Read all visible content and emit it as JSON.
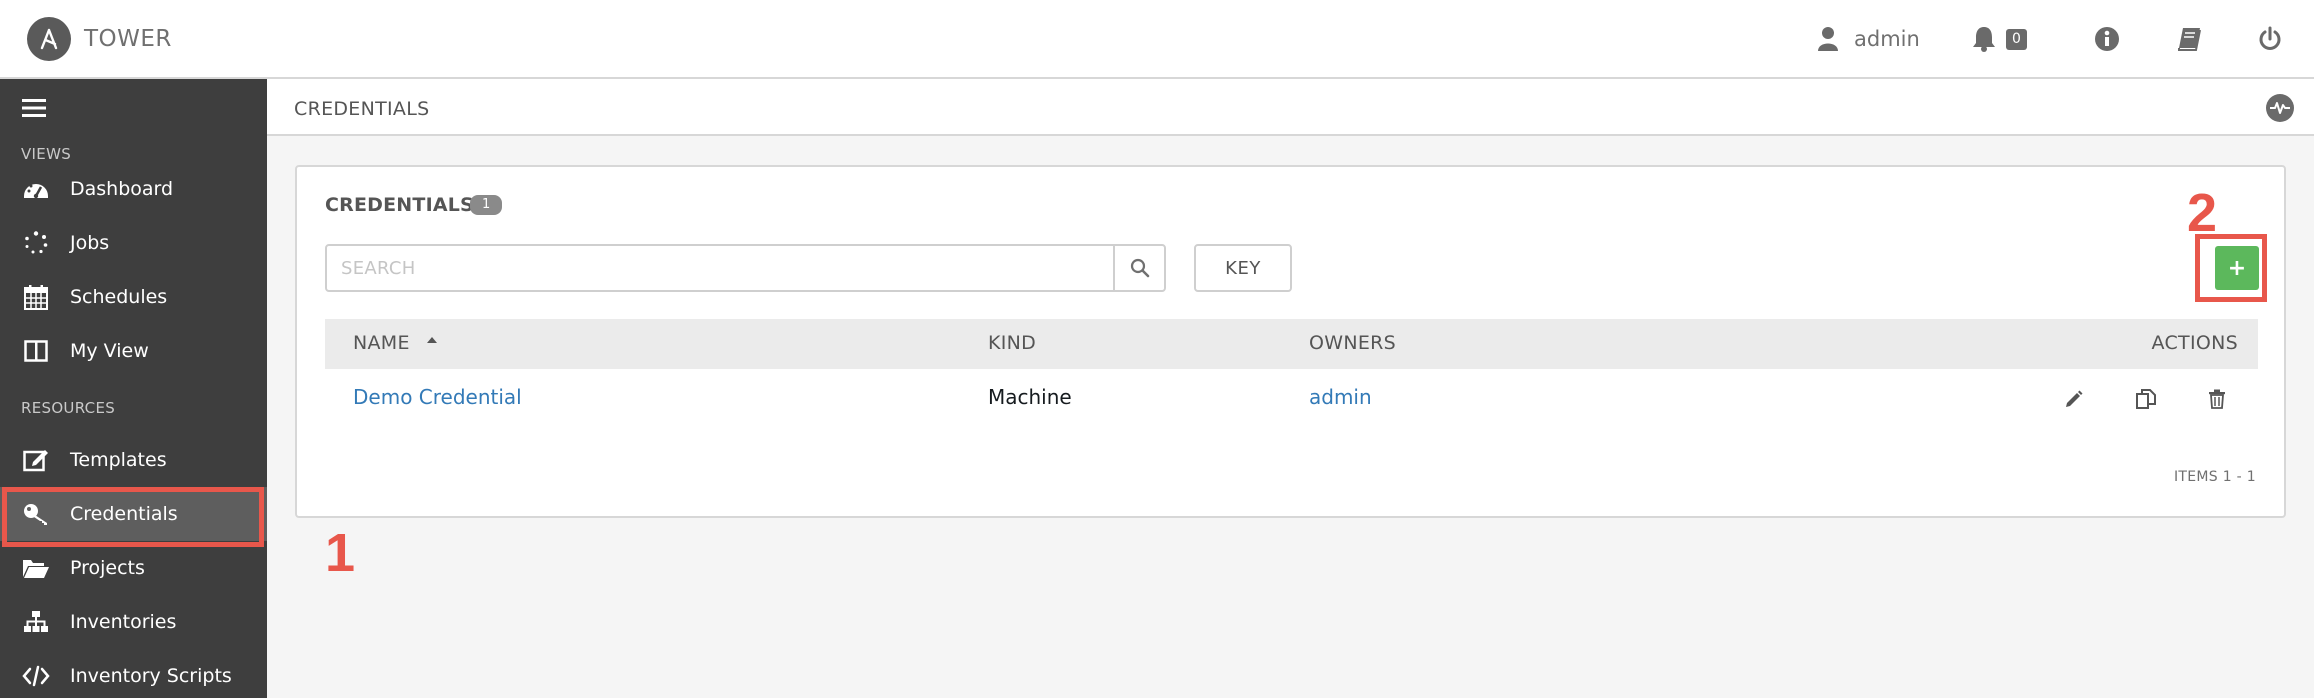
{
  "header": {
    "brand": "TOWER",
    "user": "admin",
    "notification_count": "0"
  },
  "sidebar": {
    "sections": [
      {
        "label": "VIEWS",
        "items": [
          {
            "label": "Dashboard",
            "icon": "dashboard-icon"
          },
          {
            "label": "Jobs",
            "icon": "spinner-icon"
          },
          {
            "label": "Schedules",
            "icon": "calendar-icon"
          },
          {
            "label": "My View",
            "icon": "columns-icon"
          }
        ]
      },
      {
        "label": "RESOURCES",
        "items": [
          {
            "label": "Templates",
            "icon": "edit-icon"
          },
          {
            "label": "Credentials",
            "icon": "key-icon",
            "active": true
          },
          {
            "label": "Projects",
            "icon": "folder-icon"
          },
          {
            "label": "Inventories",
            "icon": "sitemap-icon"
          },
          {
            "label": "Inventory Scripts",
            "icon": "code-icon"
          }
        ]
      }
    ]
  },
  "breadcrumb": "CREDENTIALS",
  "panel": {
    "title": "CREDENTIALS",
    "count": "1",
    "search_placeholder": "SEARCH",
    "key_label": "KEY",
    "add_label": "+",
    "columns": {
      "name": "NAME",
      "kind": "KIND",
      "owners": "OWNERS",
      "actions": "ACTIONS"
    },
    "rows": [
      {
        "name": "Demo Credential",
        "kind": "Machine",
        "owners": "admin"
      }
    ],
    "items_label": "ITEMS 1 - 1"
  },
  "annotations": [
    "1",
    "2"
  ],
  "colors": {
    "accent_red": "#e8574b",
    "add_green": "#5cb85c",
    "link_blue": "#337ab7",
    "sidebar_bg": "#3e3e3e"
  }
}
